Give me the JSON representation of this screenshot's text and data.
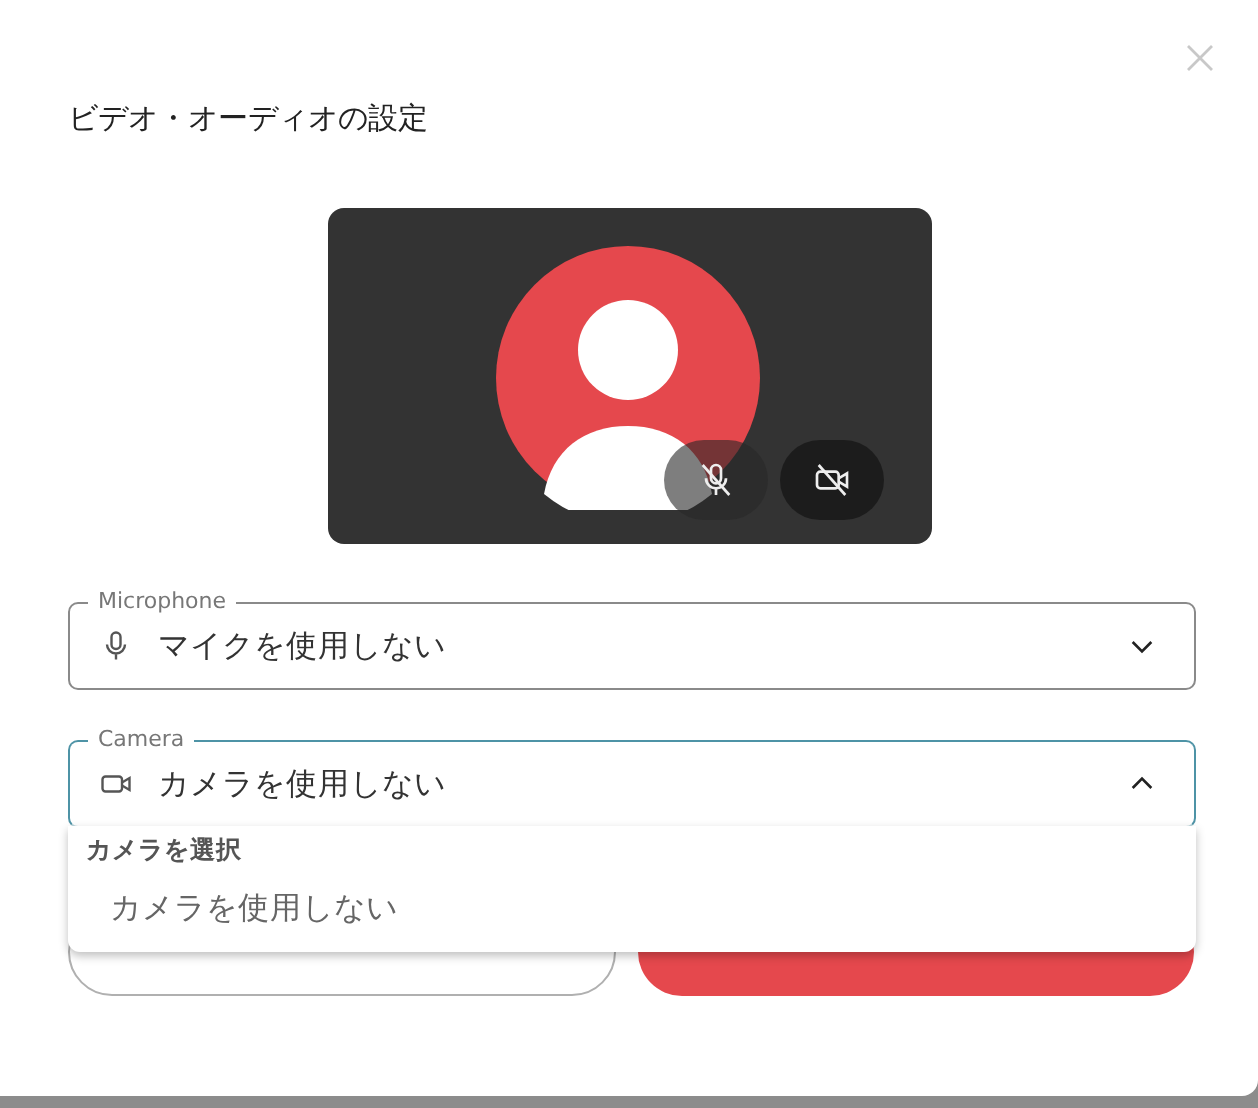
{
  "dialog": {
    "title": "ビデオ・オーディオの設定"
  },
  "preview": {
    "controls": [
      {
        "kind": "mic",
        "off": true
      },
      {
        "kind": "camera",
        "off": true
      }
    ]
  },
  "fields": [
    {
      "label": "Microphone",
      "kind": "mic",
      "value": "マイクを使用しない",
      "open": false
    },
    {
      "label": "Camera",
      "kind": "camera",
      "value": "カメラを使用しない",
      "open": true
    }
  ],
  "menu": {
    "header": "カメラを選択",
    "options": [
      {
        "label": "カメラを使用しない",
        "selected": false
      }
    ]
  },
  "buttons": [
    {
      "kind": "secondary"
    },
    {
      "kind": "primary"
    }
  ]
}
